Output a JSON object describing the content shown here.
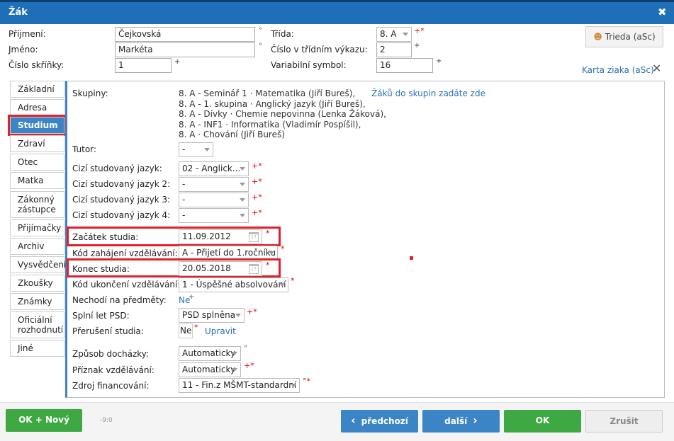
{
  "window": {
    "title": "Žák",
    "close_symbol": "✖"
  },
  "header": {
    "surname_label": "Příjmení:",
    "surname_value": "Čejkovská",
    "firstname_label": "Jméno:",
    "firstname_value": "Markéta",
    "locker_label": "Číslo skříňky:",
    "locker_value": "1",
    "class_label": "Třída:",
    "class_value": "8. A",
    "register_label": "Číslo v třídním výkazu:",
    "register_value": "2",
    "varsymbol_label": "Variabilní symbol:",
    "varsymbol_value": "16",
    "trieda_button": "Trieda (aSc)",
    "karta_link": "Karta ziaka (aSc)"
  },
  "tabs": [
    {
      "label": "Základní"
    },
    {
      "label": "Adresa"
    },
    {
      "label": "Studium"
    },
    {
      "label": "Zdraví"
    },
    {
      "label": "Otec"
    },
    {
      "label": "Matka"
    },
    {
      "label": "Zákonný zástupce"
    },
    {
      "label": "Přijímačky"
    },
    {
      "label": "Archiv"
    },
    {
      "label": "Vysvědčení"
    },
    {
      "label": "Zkoušky"
    },
    {
      "label": "Známky"
    },
    {
      "label": "Oficiální rozhodnutí"
    },
    {
      "label": "Jiné"
    }
  ],
  "active_tab": "Studium",
  "study": {
    "groups_label": "Skupiny:",
    "groups": [
      "8. A - Seminář 1 · Matematika (Jiří Bureš),",
      "8. A - 1. skupina · Anglický jazyk (Jiří Bureš),",
      "8. A - Dívky · Chemie nepovinna (Lenka Žáková),",
      "8. A - INF1 · Informatika (Vladimír Pospíšil),",
      "8. A · Chování (Jiří Bureš)"
    ],
    "groups_link": "Žáků do skupin zadáte zde",
    "tutor_label": "Tutor:",
    "tutor_value": "-",
    "lang1_label": "Cizí studovaný jazyk:",
    "lang1_value": "02 - Anglick...",
    "lang2_label": "Cizí studovaný jazyk 2:",
    "lang2_value": "-",
    "lang3_label": "Cizí studovaný jazyk 3:",
    "lang3_value": "-",
    "lang4_label": "Cizí studovaný jazyk 4:",
    "lang4_value": "-",
    "start_label": "Začátek studia:",
    "start_value": "11.09.2012",
    "startcode_label": "Kód zahájení vzdělávání:",
    "startcode_value": "A - Přijetí do 1.ročníku",
    "end_label": "Konec studia:",
    "end_value": "20.05.2018",
    "endcode_label": "Kód ukončení vzdělávání:",
    "endcode_value": "1 - Úspěšné absolvování",
    "notattend_label": "Nechodí na předměty:",
    "notattend_value": "Ne",
    "psd_label": "Splní let PSD:",
    "psd_value": "PSD splněna",
    "interrupt_label": "Přerušení studia:",
    "interrupt_value": "Ne",
    "interrupt_link": "Upravit",
    "attendance_label": "Způsob docházky:",
    "attendance_value": "Automaticky",
    "edu_flag_label": "Příznak vzdělávání:",
    "edu_flag_value": "Automaticky",
    "finance_label": "Zdroj financování:",
    "finance_value": "11 - Fin.z MŠMT-standardní"
  },
  "marks": {
    "circle": "°",
    "plus": "+",
    "star": "*",
    "plusstar": "+*",
    "circlestar": "°*"
  },
  "footer": {
    "ok_new": "OK + Nový",
    "counter": "-9:0",
    "prev": "předchozí",
    "next": "další",
    "ok": "OK",
    "cancel": "Zrušit"
  },
  "colors": {
    "accent": "#3b84c6",
    "title": "#1f6fb8",
    "ok": "#3ea843",
    "highlight": "#e0202a"
  }
}
